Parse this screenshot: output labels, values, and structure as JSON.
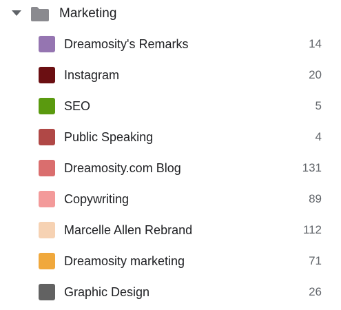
{
  "folder": {
    "name": "Marketing",
    "expanded": true,
    "icon": "folder-icon",
    "color": "#8a8a8f"
  },
  "labels": [
    {
      "name": "Dreamosity's Remarks",
      "count": "14",
      "color": "#9575b1"
    },
    {
      "name": "Instagram",
      "count": "20",
      "color": "#6b0f12"
    },
    {
      "name": "SEO",
      "count": "5",
      "color": "#5a9a0f"
    },
    {
      "name": "Public Speaking",
      "count": "4",
      "color": "#b04846"
    },
    {
      "name": "Dreamosity.com Blog",
      "count": "131",
      "color": "#da6e6e"
    },
    {
      "name": "Copywriting",
      "count": "89",
      "color": "#f39a9a"
    },
    {
      "name": "Marcelle Allen Rebrand",
      "count": "112",
      "color": "#f6d2b3"
    },
    {
      "name": "Dreamosity marketing",
      "count": "71",
      "color": "#f0a83c"
    },
    {
      "name": "Graphic Design",
      "count": "26",
      "color": "#626262"
    }
  ]
}
